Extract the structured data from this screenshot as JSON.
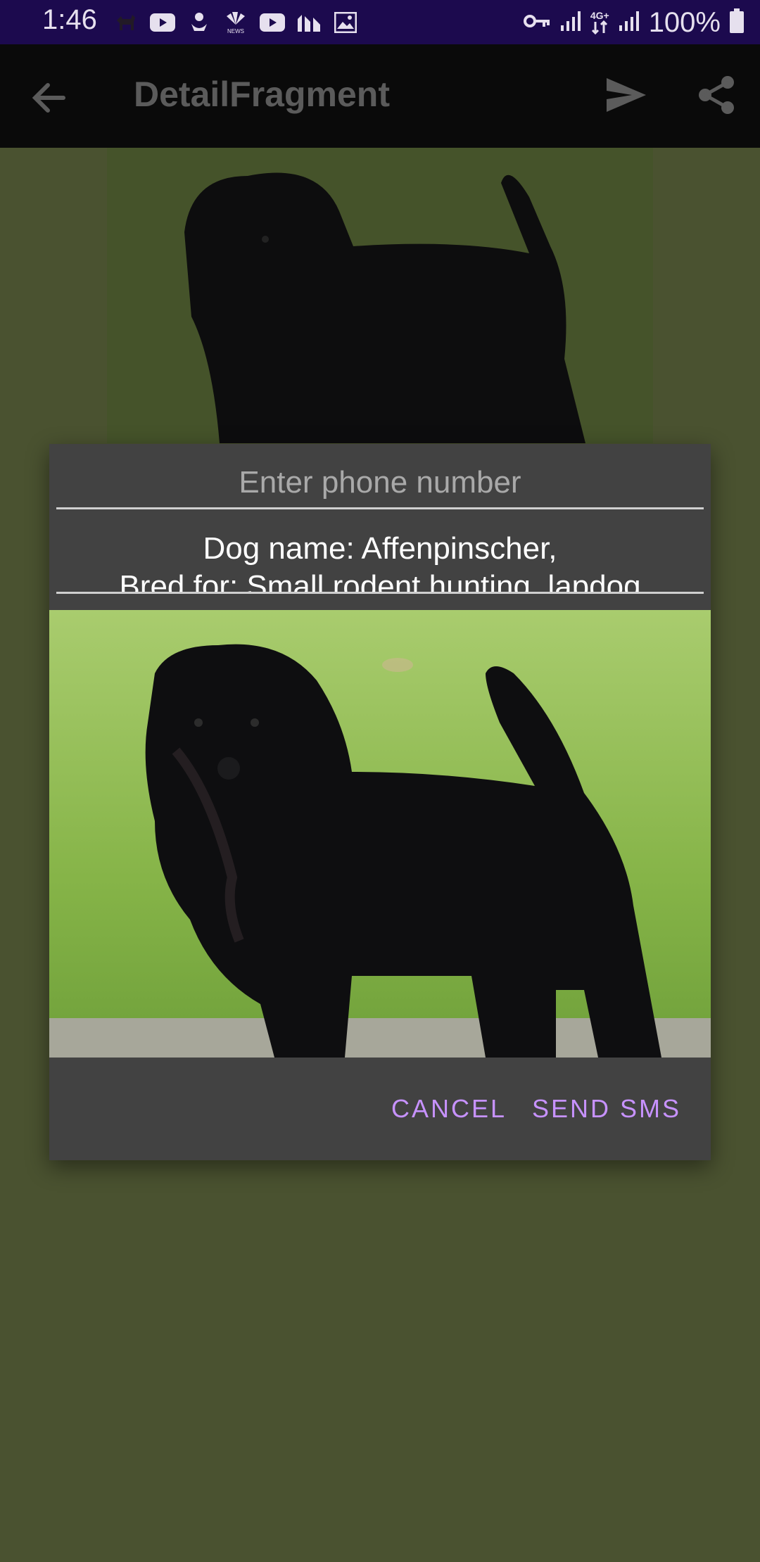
{
  "status_bar": {
    "time": "1:46",
    "battery_percent": "100%",
    "network": "4G+",
    "notification_icons": [
      "dog-icon",
      "youtube-icon",
      "bird-icon",
      "nbc-news-icon",
      "youtube-icon",
      "chart-app-icon",
      "image-icon"
    ]
  },
  "app_bar": {
    "title": "DetailFragment",
    "icons": [
      "back-arrow-icon",
      "send-icon",
      "share-icon"
    ]
  },
  "dialog": {
    "phone_placeholder": "Enter phone number",
    "phone_value": "",
    "message_line1": "Dog name: Affenpinscher,",
    "message_line2": "Bred for: Small rodent hunting, lapdog",
    "cancel_label": "CANCEL",
    "send_label": "SEND SMS"
  },
  "colors": {
    "status_bar": "#1c0a4e",
    "app_bar": "#0a0a0a",
    "background": "#4a5230",
    "dialog": "#424242",
    "accent": "#c792ff"
  }
}
